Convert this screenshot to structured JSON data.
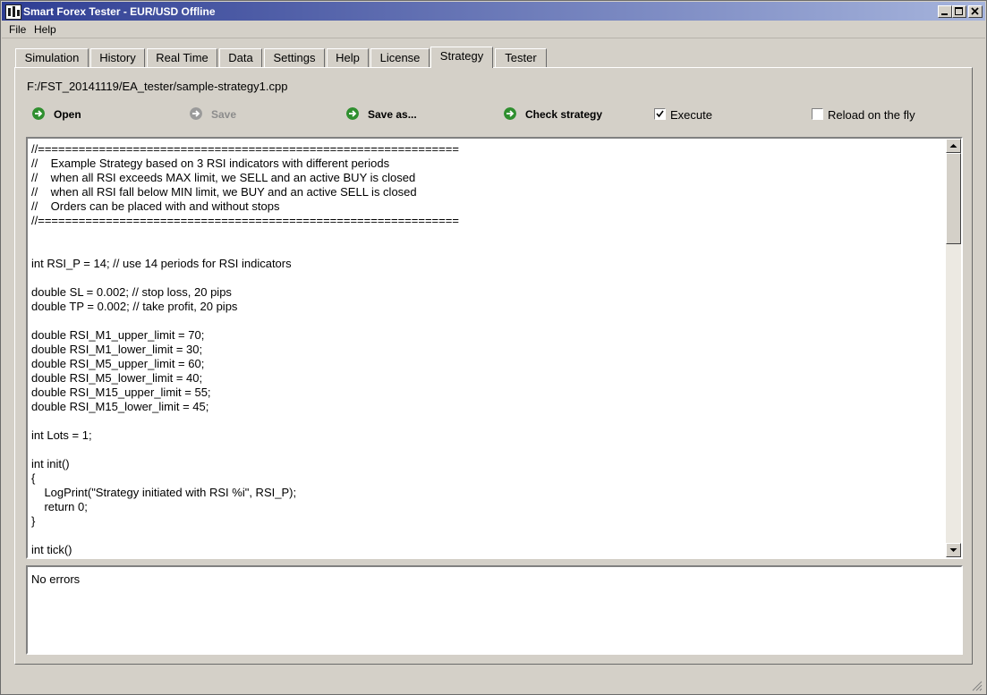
{
  "window": {
    "title": "Smart Forex Tester - EUR/USD Offline"
  },
  "menu": [
    "File",
    "Help"
  ],
  "tabs": [
    {
      "label": "Simulation",
      "active": false
    },
    {
      "label": "History",
      "active": false
    },
    {
      "label": "Real Time",
      "active": false
    },
    {
      "label": "Data",
      "active": false
    },
    {
      "label": "Settings",
      "active": false
    },
    {
      "label": "Help",
      "active": false
    },
    {
      "label": "License",
      "active": false
    },
    {
      "label": "Strategy",
      "active": true
    },
    {
      "label": "Tester",
      "active": false
    }
  ],
  "strategy": {
    "file_path": "F:/FST_20141119/EA_tester/sample-strategy1.cpp",
    "toolbar": {
      "open": {
        "label": "Open",
        "icon": "arrow-right-circle-icon",
        "enabled": true
      },
      "save": {
        "label": "Save",
        "icon": "arrow-right-circle-icon",
        "enabled": false
      },
      "save_as": {
        "label": "Save as...",
        "icon": "arrow-right-circle-icon",
        "enabled": true
      },
      "check": {
        "label": "Check strategy",
        "icon": "arrow-right-circle-icon",
        "enabled": true
      }
    },
    "execute": {
      "label": "Execute",
      "checked": true
    },
    "reload": {
      "label": "Reload on the fly",
      "checked": false
    },
    "code_lines": [
      "//==============================================================",
      "//    Example Strategy based on 3 RSI indicators with different periods",
      "//    when all RSI exceeds MAX limit, we SELL and an active BUY is closed",
      "//    when all RSI fall below MIN limit, we BUY and an active SELL is closed",
      "//    Orders can be placed with and without stops",
      "//==============================================================",
      "",
      "",
      "int RSI_P = 14; // use 14 periods for RSI indicators",
      "",
      "double SL = 0.002; // stop loss, 20 pips",
      "double TP = 0.002; // take profit, 20 pips",
      "",
      "double RSI_M1_upper_limit = 70;",
      "double RSI_M1_lower_limit = 30;",
      "double RSI_M5_upper_limit = 60;",
      "double RSI_M5_lower_limit = 40;",
      "double RSI_M15_upper_limit = 55;",
      "double RSI_M15_lower_limit = 45;",
      "",
      "int Lots = 1;",
      "",
      "int init()",
      "{",
      "    LogPrint(\"Strategy initiated with RSI %i\", RSI_P);",
      "    return 0;",
      "}",
      "",
      "int tick()"
    ],
    "output": "No errors"
  },
  "colors": {
    "titlebar_start": "#2e3d93",
    "titlebar_end": "#a6b4dc",
    "icon_green": "#2f8f2f",
    "icon_disabled": "#9a9a9a"
  }
}
